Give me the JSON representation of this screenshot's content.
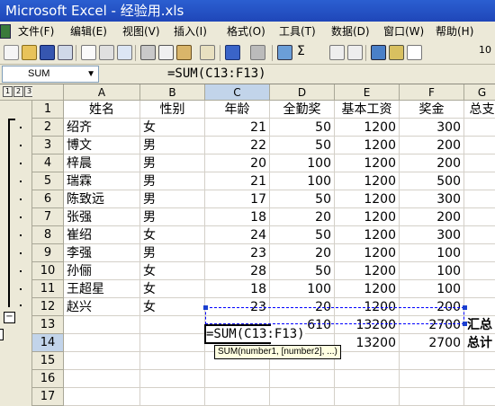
{
  "window": {
    "title": "Microsoft Excel - 经验用.xls"
  },
  "menu": {
    "items": [
      "文件(F)",
      "编辑(E)",
      "视图(V)",
      "插入(I)",
      "格式(O)",
      "工具(T)",
      "数据(D)",
      "窗口(W)",
      "帮助(H)"
    ]
  },
  "toolbar": {
    "sigma": "Σ",
    "zoom": "10"
  },
  "formula_bar": {
    "name_box": "SUM",
    "fx": "✕ ✓ fx",
    "formula": "=SUM(C13:F13)"
  },
  "outline": {
    "levels": [
      "1",
      "2",
      "3"
    ],
    "collapse": "−"
  },
  "sheet": {
    "columns": [
      "A",
      "B",
      "C",
      "D",
      "E",
      "F",
      "G"
    ],
    "headers": [
      "姓名",
      "性别",
      "年龄",
      "全勤奖",
      "基本工资",
      "奖金",
      "总支"
    ],
    "rows": [
      [
        "绍齐",
        "女",
        "21",
        "50",
        "1200",
        "300"
      ],
      [
        "博文",
        "男",
        "22",
        "50",
        "1200",
        "200"
      ],
      [
        "梓晨",
        "男",
        "20",
        "100",
        "1200",
        "200"
      ],
      [
        "瑞霖",
        "男",
        "21",
        "100",
        "1200",
        "500"
      ],
      [
        "陈致远",
        "男",
        "17",
        "50",
        "1200",
        "300"
      ],
      [
        "张强",
        "男",
        "18",
        "20",
        "1200",
        "200"
      ],
      [
        "崔绍",
        "女",
        "24",
        "50",
        "1200",
        "300"
      ],
      [
        "李强",
        "男",
        "23",
        "20",
        "1200",
        "100"
      ],
      [
        "孙俪",
        "女",
        "28",
        "50",
        "1200",
        "100"
      ],
      [
        "王超星",
        "女",
        "18",
        "100",
        "1200",
        "100"
      ],
      [
        "赵兴",
        "女",
        "23",
        "20",
        "1200",
        "200"
      ]
    ],
    "row13": {
      "D": "610",
      "E": "13200",
      "F": "2700",
      "G": "汇总"
    },
    "row14": {
      "C": "=SUM(C13:F13)",
      "E": "13200",
      "F": "2700",
      "G": "总计"
    },
    "row_numbers": [
      "1",
      "2",
      "3",
      "4",
      "5",
      "6",
      "7",
      "8",
      "9",
      "10",
      "11",
      "12",
      "13",
      "14",
      "15",
      "16",
      "17",
      "18"
    ],
    "tooltip": "SUM(number1, [number2], ...)"
  }
}
